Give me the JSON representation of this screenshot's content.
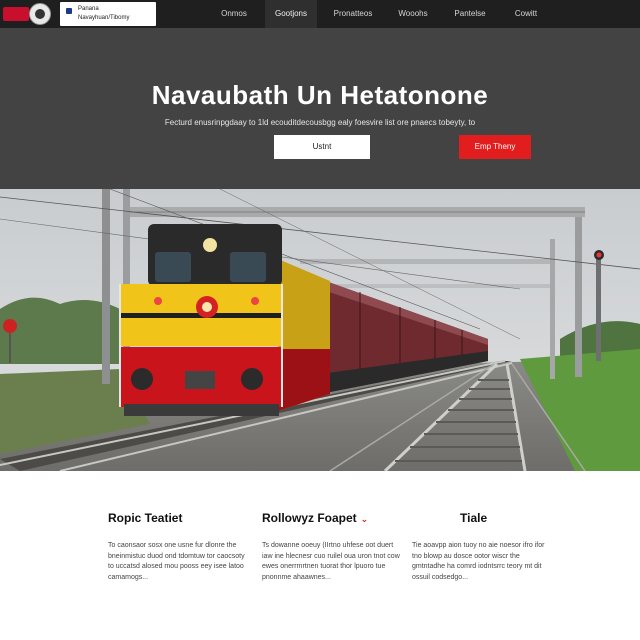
{
  "nav": {
    "brand": {
      "name": "Panana",
      "tagline": "Navayhuan/Tibomy"
    },
    "links": [
      "Onmos",
      "Gootjons",
      "Pronatteos",
      "Wooohs",
      "Pantelse",
      "Cowitt"
    ],
    "active_index": 1
  },
  "hero": {
    "title": "Navaubath Un Hetatonone",
    "subtitle": "Fecturd enusrinpgdaay to 1ld ecouditdecousbgg ealy foesvire list ore pnaecs tobeyty, to",
    "primary_button": "Ustnt",
    "secondary_button": "Emp Theny"
  },
  "features": [
    {
      "title": "Ropic Teatiet",
      "body": "To caonsaor sosx one usne fur dlonre the bneinmistuc duod ond tdomtuw tor caocsoty to uccatsd alosed mou pooss eey isee latoo camamogs..."
    },
    {
      "title": "Rollowyz Foapet",
      "body": "Ts dowanne ooeuy (IIrtno uhfese oot duert iaw ine hlecnesr cuo ruilel oua uron tnot cow ewes onerrmrtnen tuorat thor lpuoro tue pnonnme ahaawnes..."
    },
    {
      "title": "Tiale",
      "body": "Tie aoavpp aion tuoy no aie noesor ifro ifor tno blowp au dosce ootor wiscr the gmtntadhe ha comrd iodntsrrc teory mt dit ossuil codsedgo..."
    }
  ],
  "colors": {
    "nav_bg": "#1f1f1f",
    "hero_bg": "#434343",
    "accent_red": "#e21d1d",
    "locomotive_yellow": "#f0c419",
    "locomotive_red": "#c8141a"
  }
}
